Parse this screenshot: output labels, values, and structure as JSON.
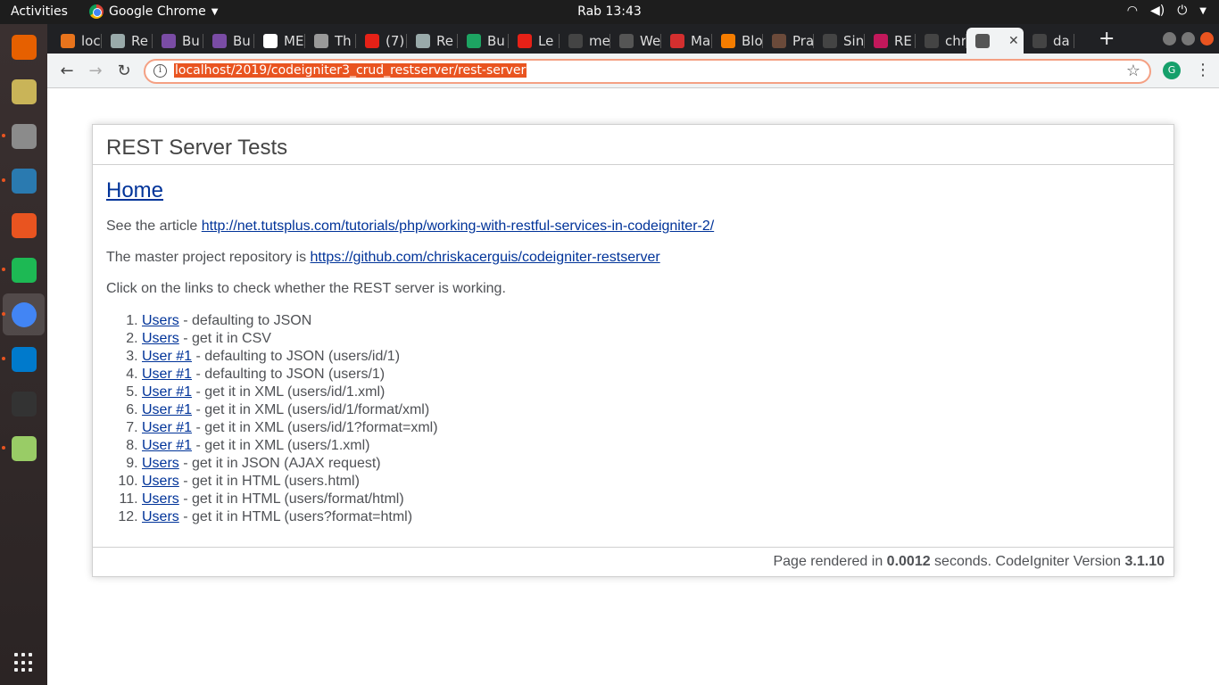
{
  "system_bar": {
    "activities": "Activities",
    "app_name": "Google Chrome",
    "clock": "Rab 13:43"
  },
  "browser": {
    "tabs": [
      {
        "label": "loc",
        "icon": "xampp-icon",
        "color": "#e8741c"
      },
      {
        "label": "Re",
        "icon": "appgini-icon",
        "color": "#9aa"
      },
      {
        "label": "Bu",
        "icon": "bit-icon",
        "color": "#7a4ca5"
      },
      {
        "label": "Bu",
        "icon": "bit-icon",
        "color": "#7a4ca5"
      },
      {
        "label": "ME",
        "icon": "medium-icon",
        "color": "#fff"
      },
      {
        "label": "Th",
        "icon": "figma-icon",
        "color": "#999"
      },
      {
        "label": "(7)",
        "icon": "youtube-icon",
        "color": "#e62117"
      },
      {
        "label": "Re",
        "icon": "appgini-icon",
        "color": "#9aa"
      },
      {
        "label": "Bu",
        "icon": "django-icon",
        "color": "#1da462"
      },
      {
        "label": "Le",
        "icon": "youtube-icon",
        "color": "#e62117"
      },
      {
        "label": "me",
        "icon": "github-icon",
        "color": "#444"
      },
      {
        "label": "We",
        "icon": "globe-icon",
        "color": "#555"
      },
      {
        "label": "Ma",
        "icon": "pdf-icon",
        "color": "#d32f2f"
      },
      {
        "label": "Blo",
        "icon": "blogger-icon",
        "color": "#f57d00"
      },
      {
        "label": "Pra",
        "icon": "avatar-icon",
        "color": "#6b4a3a"
      },
      {
        "label": "Sin",
        "icon": "github-icon",
        "color": "#444"
      },
      {
        "label": "RE",
        "icon": "colorful-icon",
        "color": "#c2185b"
      },
      {
        "label": "chr",
        "icon": "github-icon",
        "color": "#444"
      },
      {
        "label": "",
        "icon": "globe-icon",
        "color": "#555",
        "active": true,
        "close": "✕"
      },
      {
        "label": "da",
        "icon": "github-icon",
        "color": "#444"
      }
    ],
    "new_tab": "+",
    "url": "localhost/2019/codeigniter3_crud_restserver/rest-server",
    "info_glyph": "i",
    "bookmark_glyph": "☆",
    "extension_label": "G"
  },
  "page": {
    "title": "REST Server Tests",
    "home_link": "Home",
    "article_prefix": "See the article ",
    "article_link": "http://net.tutsplus.com/tutorials/php/working-with-restful-services-in-codeigniter-2/",
    "repo_prefix": "The master project repository is ",
    "repo_link": "https://github.com/chriskacerguis/codeigniter-restserver",
    "instructions": "Click on the links to check whether the REST server is working.",
    "tests": [
      {
        "link": "Users",
        "desc": " - defaulting to JSON"
      },
      {
        "link": "Users",
        "desc": " - get it in CSV"
      },
      {
        "link": "User #1",
        "desc": " - defaulting to JSON (users/id/1)"
      },
      {
        "link": "User #1",
        "desc": " - defaulting to JSON (users/1)"
      },
      {
        "link": "User #1",
        "desc": " - get it in XML (users/id/1.xml)"
      },
      {
        "link": "User #1",
        "desc": " - get it in XML (users/id/1/format/xml)"
      },
      {
        "link": "User #1",
        "desc": " - get it in XML (users/id/1?format=xml)"
      },
      {
        "link": "User #1",
        "desc": " - get it in XML (users/1.xml)"
      },
      {
        "link": "Users",
        "desc": " - get it in JSON (AJAX request)"
      },
      {
        "link": "Users",
        "desc": " - get it in HTML (users.html)"
      },
      {
        "link": "Users",
        "desc": " - get it in HTML (users/format/html)"
      },
      {
        "link": "Users",
        "desc": " - get it in HTML (users?format=html)"
      }
    ],
    "footer": {
      "prefix": "Page rendered in ",
      "time": "0.0012",
      "middle": " seconds. CodeIgniter Version ",
      "version": "3.1.10"
    }
  },
  "dock": [
    {
      "name": "firefox-icon",
      "color": "#e66000",
      "pip": false
    },
    {
      "name": "rhythmbox-icon",
      "color": "#c9b458",
      "pip": false
    },
    {
      "name": "files-icon",
      "color": "#8b8b8b",
      "pip": true
    },
    {
      "name": "libreoffice-impress-icon",
      "color": "#2a7ab0",
      "pip": true
    },
    {
      "name": "software-center-icon",
      "color": "#e95420",
      "pip": false
    },
    {
      "name": "spotify-icon",
      "color": "#1db954",
      "pip": true
    },
    {
      "name": "chrome-icon",
      "color": "#4285f4",
      "pip": true,
      "active": true
    },
    {
      "name": "vscode-icon",
      "color": "#007acc",
      "pip": true
    },
    {
      "name": "terminal-icon",
      "color": "#333",
      "pip": false
    },
    {
      "name": "image-viewer-icon",
      "color": "#9c6",
      "pip": true
    }
  ]
}
